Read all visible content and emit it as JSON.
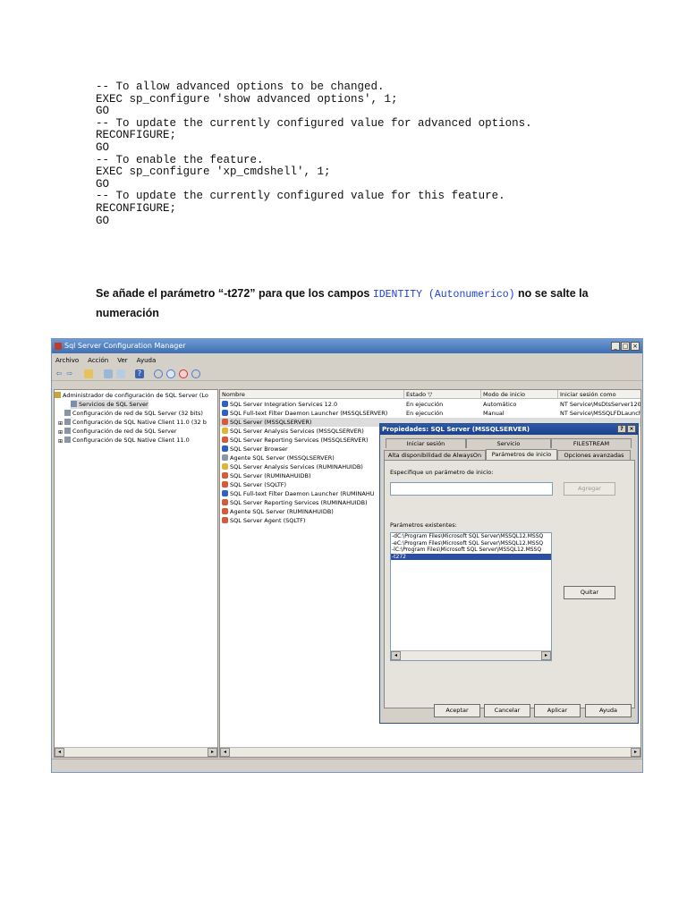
{
  "code_lines": [
    "-- To allow advanced options to be changed.",
    "EXEC sp_configure 'show advanced options', 1;",
    "GO",
    "-- To update the currently configured value for advanced options.",
    "RECONFIGURE;",
    "GO",
    "-- To enable the feature.",
    "EXEC sp_configure 'xp_cmdshell', 1;",
    "GO",
    "-- To update the currently configured value for this feature.",
    "RECONFIGURE;",
    "GO"
  ],
  "paragraph": {
    "before": "Se añade el parámetro “-t272” para que los campos ",
    "keyword": "IDENTITY (Autonumerico)",
    "after": " no se salte la numeración"
  },
  "window": {
    "title": "Sql Server Configuration Manager",
    "title_buttons": [
      "_",
      "□",
      "×"
    ],
    "menu": [
      "Archivo",
      "Acción",
      "Ver",
      "Ayuda"
    ],
    "tree": [
      "Administrador de configuración de SQL Server (Lo",
      "Servicios de SQL Server",
      "Configuración de red de SQL Server (32 bits)",
      "Configuración de SQL Native Client 11.0 (32 b",
      "Configuración de red de SQL Server",
      "Configuración de SQL Native Client 11.0"
    ],
    "columns": [
      "Nombre",
      "Estado",
      "Modo de inicio",
      "Iniciar sesión como"
    ],
    "sort_indicator": "▽",
    "rows": [
      {
        "name": "SQL Server Integration Services 12.0",
        "state": "En ejecución",
        "mode": "Automático",
        "login": "NT Service\\MsDtsServer120"
      },
      {
        "name": "SQL Full-text Filter Daemon Launcher (MSSQLSERVER)",
        "state": "En ejecución",
        "mode": "Manual",
        "login": "NT Service\\MSSQLFDLauncher"
      },
      {
        "name": "SQL Server (MSSQLSERVER)",
        "state": "",
        "mode": "",
        "login": ""
      },
      {
        "name": "SQL Server Analysis Services (MSSQLSERVER)",
        "state": "",
        "mode": "",
        "login": ""
      },
      {
        "name": "SQL Server Reporting Services (MSSQLSERVER)",
        "state": "",
        "mode": "",
        "login": ""
      },
      {
        "name": "SQL Server Browser",
        "state": "",
        "mode": "",
        "login": ""
      },
      {
        "name": "Agente SQL Server (MSSQLSERVER)",
        "state": "",
        "mode": "",
        "login": ""
      },
      {
        "name": "SQL Server Analysis Services (RUMINAHUIDB)",
        "state": "",
        "mode": "",
        "login": ""
      },
      {
        "name": "SQL Server (RUMINAHUIDB)",
        "state": "",
        "mode": "",
        "login": ""
      },
      {
        "name": "SQL Server (SQLTF)",
        "state": "",
        "mode": "",
        "login": ""
      },
      {
        "name": "SQL Full-text Filter Daemon Launcher (RUMINAHU",
        "state": "",
        "mode": "",
        "login": ""
      },
      {
        "name": "SQL Server Reporting Services (RUMINAHUIDB)",
        "state": "",
        "mode": "",
        "login": ""
      },
      {
        "name": "Agente SQL Server (RUMINAHUIDB)",
        "state": "",
        "mode": "",
        "login": ""
      },
      {
        "name": "SQL Server Agent (SQLTF)",
        "state": "",
        "mode": "",
        "login": ""
      }
    ]
  },
  "dialog": {
    "title": "Propiedades: SQL Server (MSSQLSERVER)",
    "help": "?",
    "close": "×",
    "tabs_row1": [
      "Iniciar sesión",
      "Servicio",
      "FILESTREAM"
    ],
    "tabs_row2": [
      "Alta disponibilidad de AlwaysOn",
      "Parámetros de inicio",
      "Opciones avanzadas"
    ],
    "spec_label": "Especifique un parámetro de inicio:",
    "add_button": "Agregar",
    "existing_label": "Parámetros existentes:",
    "params": [
      "-dC:\\Program Files\\Microsoft SQL Server\\MSSQL12.MSSQ",
      "-eC:\\Program Files\\Microsoft SQL Server\\MSSQL12.MSSQ",
      "-lC:\\Program Files\\Microsoft SQL Server\\MSSQL12.MSSQ",
      "-t272"
    ],
    "remove_button": "Quitar",
    "buttons": [
      "Aceptar",
      "Cancelar",
      "Aplicar",
      "Ayuda"
    ]
  },
  "colors": {
    "keyword": "#1f3fcf",
    "selection": "#2a4fa3",
    "titlebar": "#3e6fb1"
  }
}
